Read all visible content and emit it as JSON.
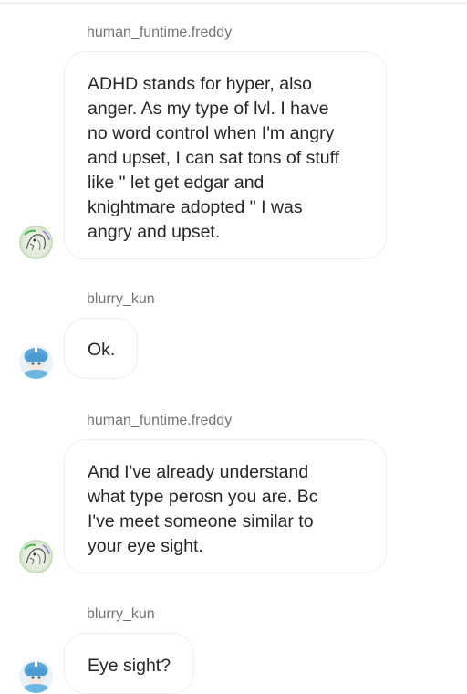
{
  "conversation": {
    "messages": [
      {
        "sender": "human_funtime.freddy",
        "text": "ADHD stands for hyper, also\nanger. As my type of lvl. I have\nno word control when I'm angry\nand upset, I can sat tons of stuff\nlike \" let get edgar and\nknightmare adopted \" I was\nangry and upset."
      },
      {
        "sender": "blurry_kun",
        "text": "Ok."
      },
      {
        "sender": "human_funtime.freddy",
        "text": "And I've already understand\nwhat type perosn you are. Bc\nI've meet someone similar to\nyour eye sight."
      },
      {
        "sender": "blurry_kun",
        "text": "Eye sight?"
      }
    ]
  },
  "icons": {
    "avatar_human_funtime": "avatar-sketch-icon",
    "avatar_blurry_kun": "avatar-blue-character-icon"
  },
  "colors": {
    "sender_text": "#737373",
    "message_text": "#262626",
    "bubble_border": "#efefef"
  }
}
